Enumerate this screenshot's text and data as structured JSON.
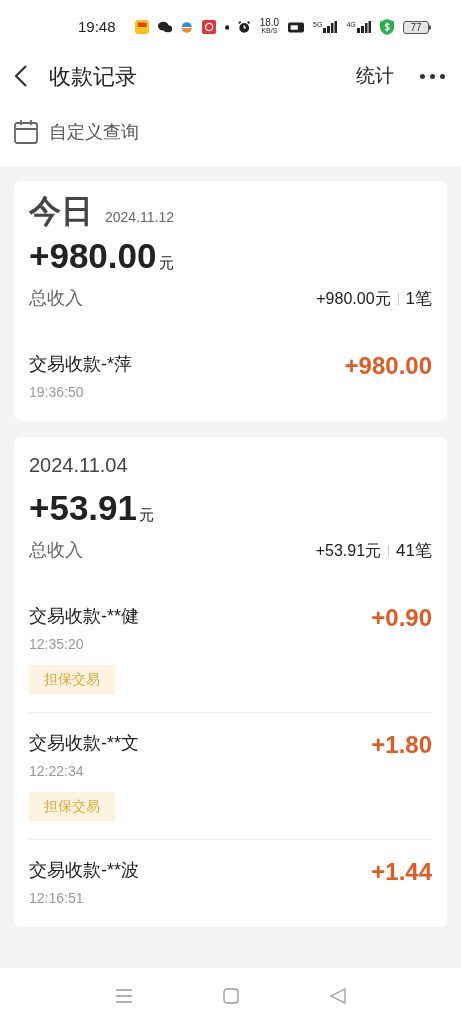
{
  "status_bar": {
    "time": "19:48",
    "net_speed": "18.0",
    "net_unit": "KB/S",
    "signal_1": "5G",
    "signal_2": "4G",
    "battery": "77"
  },
  "header": {
    "title": "收款记录",
    "action": "统计"
  },
  "filter": {
    "label": "自定义查询"
  },
  "groups": [
    {
      "kind": "today",
      "title": "今日",
      "date": "2024.11.12",
      "amount": "+980.00",
      "unit": "元",
      "total_label": "总收入",
      "total": "+980.00元",
      "count": "1笔",
      "transactions": [
        {
          "name": "交易收款-*萍",
          "time": "19:36:50",
          "amount": "+980.00"
        }
      ]
    },
    {
      "kind": "date",
      "title": "2024.11.04",
      "amount": "+53.91",
      "unit": "元",
      "total_label": "总收入",
      "total": "+53.91元",
      "count": "41笔",
      "transactions": [
        {
          "name": "交易收款-**健",
          "time": "12:35:20",
          "amount": "+0.90",
          "tag": "担保交易"
        },
        {
          "name": "交易收款-**文",
          "time": "12:22:34",
          "amount": "+1.80",
          "tag": "担保交易"
        },
        {
          "name": "交易收款-**波",
          "time": "12:16:51",
          "amount": "+1.44"
        }
      ]
    }
  ]
}
